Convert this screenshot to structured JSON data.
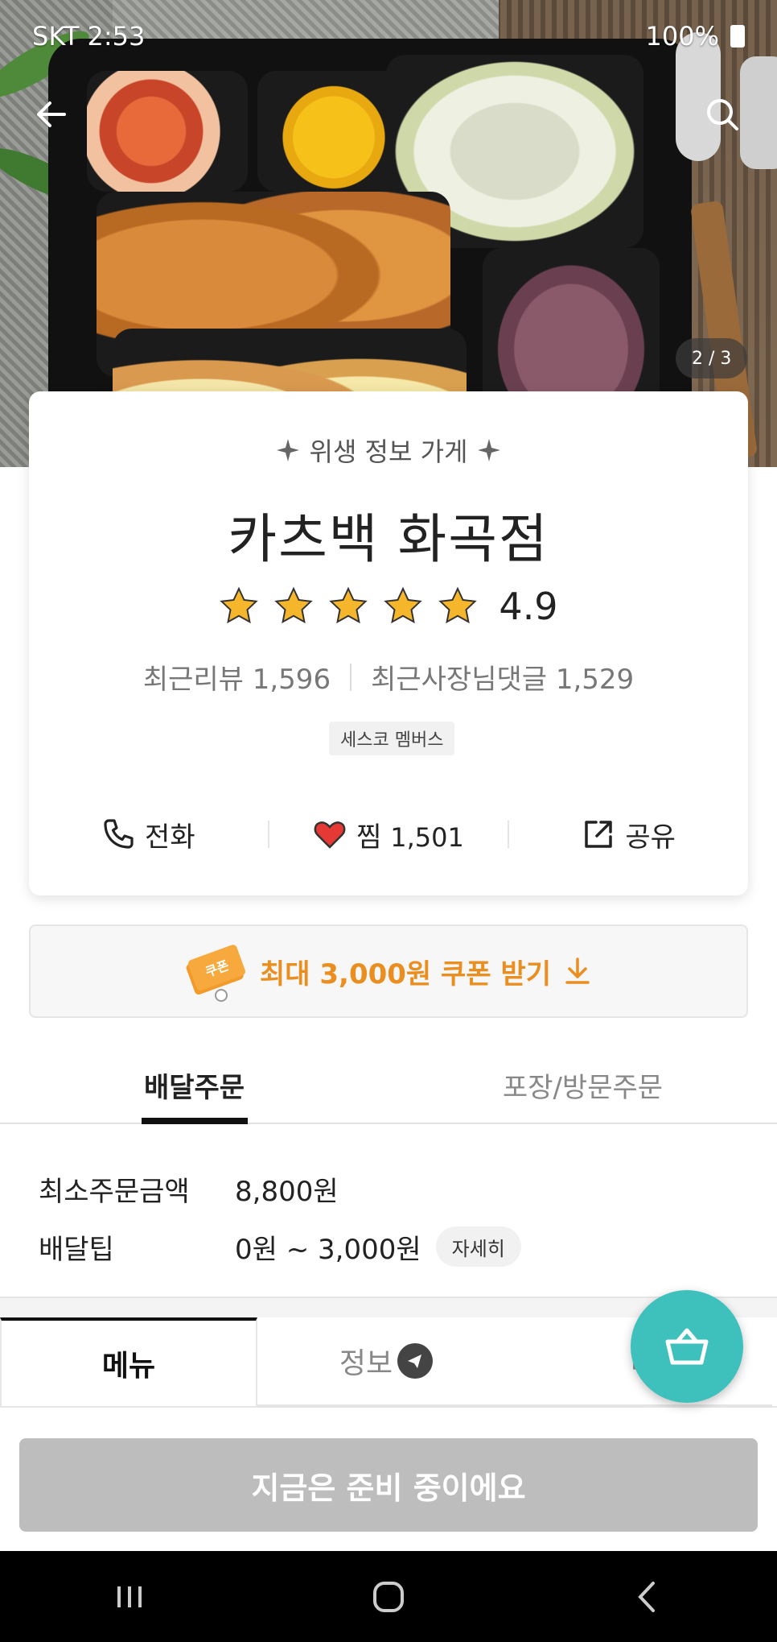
{
  "status_bar": {
    "carrier_time": "SKT 2:53",
    "battery": "100%"
  },
  "hero": {
    "page_indicator": "2 / 3"
  },
  "store": {
    "hygiene_label": "위생 정보 가게",
    "name": "카츠백 화곡점",
    "rating": "4.9",
    "rating_stars": 5,
    "recent_reviews": "최근리뷰 1,596",
    "owner_replies": "최근사장님댓글 1,529",
    "member_badge": "세스코 멤버스"
  },
  "actions": {
    "call": "전화",
    "like": "찜",
    "like_count": "1,501",
    "share": "공유"
  },
  "coupon": {
    "label": "최대 3,000원 쿠폰 받기",
    "ticket_text": "쿠폰"
  },
  "order_tabs": {
    "delivery": "배달주문",
    "pickup": "포장/방문주문"
  },
  "delivery_info": {
    "min_order_label": "최소주문금액",
    "min_order_value": "8,800원",
    "tip_label": "배달팁",
    "tip_value": "0원 ~ 3,000원",
    "detail_button": "자세히"
  },
  "menu_tabs": {
    "menu": "메뉴",
    "info": "정보",
    "review": "리"
  },
  "bottom_button": "지금은 준비 중이에요",
  "colors": {
    "accent_orange": "#e98e1f",
    "fab_teal": "#3ec1bd",
    "star": "#f6b62b"
  },
  "icons": {
    "back": "arrow-left-icon",
    "search": "search-icon",
    "phone": "phone-icon",
    "heart": "heart-icon",
    "share": "share-icon",
    "download": "download-icon",
    "cart": "basket-icon",
    "info_badge": "megaphone-icon"
  }
}
